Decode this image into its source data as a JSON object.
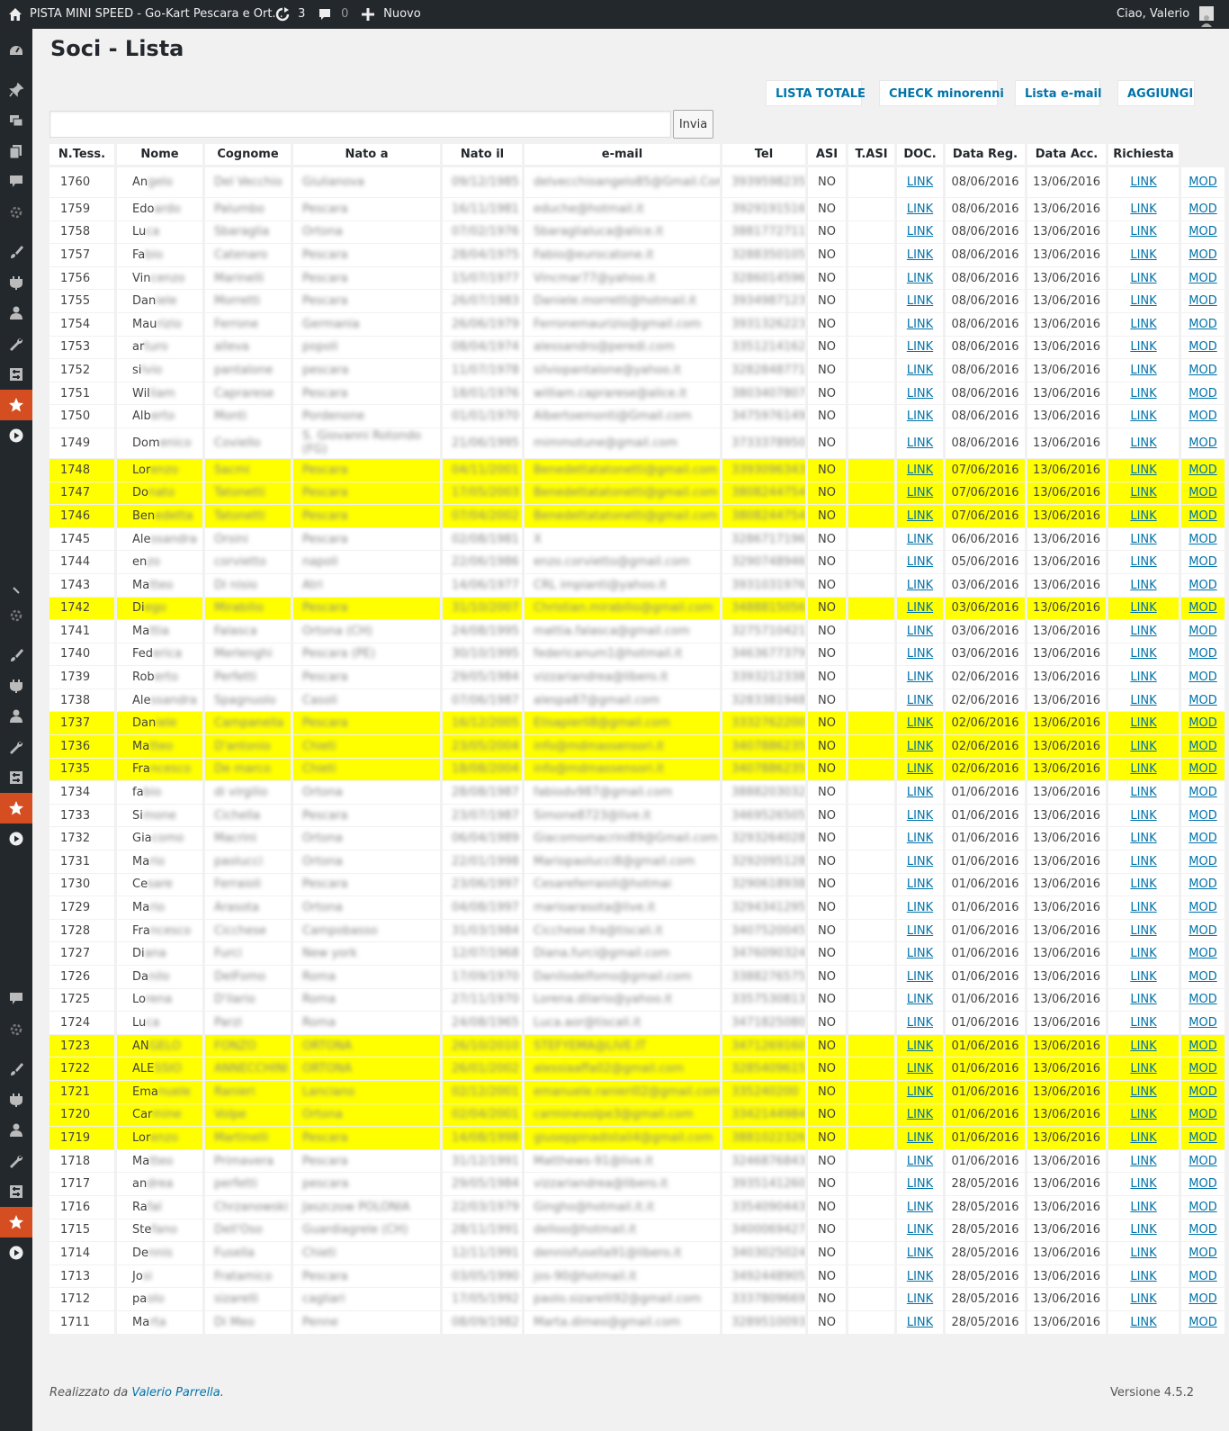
{
  "adminbar": {
    "site_title": "PISTA MINI SPEED - Go-Kart Pescara e Ort...",
    "updates_count": "3",
    "comments_count": "0",
    "new_label": "Nuovo",
    "greeting": "Ciao, Valerio"
  },
  "page": {
    "title": "Soci - Lista",
    "buttons": {
      "lista_totale": "LISTA TOTALE",
      "check_minorenni": "CHECK minorenni",
      "lista_email": "Lista e-mail",
      "aggiungi": "AGGIUNGI"
    },
    "search": {
      "value": "",
      "submit": "Invia"
    }
  },
  "table": {
    "headers": [
      "N.Tess.",
      "Nome",
      "Cognome",
      "Nato a",
      "Nato il",
      "e-mail",
      "Tel",
      "ASI",
      "T.ASI",
      "DOC.",
      "Data Reg.",
      "Data Acc.",
      "Richiesta"
    ],
    "link_label": "LINK",
    "mod_label": "MOD",
    "rows": [
      {
        "n": "1760",
        "nome": "Angelo",
        "cognome": "Del Vecchio",
        "nato_a": "Giulianova",
        "nato_il": "09/12/1985",
        "email": "delvecchioangelo85@Gmail.Com",
        "tel": "3939598235",
        "asi": "NO",
        "tasi": "",
        "reg": "08/06/2016",
        "acc": "13/06/2016",
        "hl": false,
        "tall": true
      },
      {
        "n": "1759",
        "nome": "Edoardo",
        "cognome": "Palumbo",
        "nato_a": "Pescara",
        "nato_il": "16/11/1981",
        "email": "eduche@hotmail.it",
        "tel": "3929191516",
        "asi": "NO",
        "tasi": "",
        "reg": "08/06/2016",
        "acc": "13/06/2016",
        "hl": false
      },
      {
        "n": "1758",
        "nome": "Luca",
        "cognome": "Sbaraglia",
        "nato_a": "Ortona",
        "nato_il": "07/02/1976",
        "email": "Sbaraglialuca@alice.it",
        "tel": "3881772711",
        "asi": "NO",
        "tasi": "",
        "reg": "08/06/2016",
        "acc": "13/06/2016",
        "hl": false
      },
      {
        "n": "1757",
        "nome": "Fabio",
        "cognome": "Catenaro",
        "nato_a": "Pescara",
        "nato_il": "28/04/1975",
        "email": "Fabio@eurocatone.it",
        "tel": "3288350105",
        "asi": "NO",
        "tasi": "",
        "reg": "08/06/2016",
        "acc": "13/06/2016",
        "hl": false
      },
      {
        "n": "1756",
        "nome": "Vincenzo",
        "cognome": "Marinelli",
        "nato_a": "Pescara",
        "nato_il": "15/07/1977",
        "email": "Vincmar77@yahoo.it",
        "tel": "3286014596",
        "asi": "NO",
        "tasi": "",
        "reg": "08/06/2016",
        "acc": "13/06/2016",
        "hl": false
      },
      {
        "n": "1755",
        "nome": "Daniele",
        "cognome": "Morretti",
        "nato_a": "Pescara",
        "nato_il": "26/07/1983",
        "email": "Daniele.morretti@hotmail.it",
        "tel": "3934987123",
        "asi": "NO",
        "tasi": "",
        "reg": "08/06/2016",
        "acc": "13/06/2016",
        "hl": false
      },
      {
        "n": "1754",
        "nome": "Maurizio",
        "cognome": "Ferrone",
        "nato_a": "Germania",
        "nato_il": "26/06/1979",
        "email": "Ferronemaurizio@gmail.com",
        "tel": "3931326223",
        "asi": "NO",
        "tasi": "",
        "reg": "08/06/2016",
        "acc": "13/06/2016",
        "hl": false
      },
      {
        "n": "1753",
        "nome": "arturo",
        "cognome": "alleva",
        "nato_a": "popoli",
        "nato_il": "08/04/1974",
        "email": "alessandro@peredi.com",
        "tel": "3351214162",
        "asi": "NO",
        "tasi": "",
        "reg": "08/06/2016",
        "acc": "13/06/2016",
        "hl": false
      },
      {
        "n": "1752",
        "nome": "silvio",
        "cognome": "pantalone",
        "nato_a": "pescara",
        "nato_il": "11/07/1978",
        "email": "silviopantalone@yahoo.it",
        "tel": "3282848771",
        "asi": "NO",
        "tasi": "",
        "reg": "08/06/2016",
        "acc": "13/06/2016",
        "hl": false
      },
      {
        "n": "1751",
        "nome": "William",
        "cognome": "Caprarese",
        "nato_a": "Pescara",
        "nato_il": "18/01/1976",
        "email": "william.caprarese@alice.it",
        "tel": "3803407807",
        "asi": "NO",
        "tasi": "",
        "reg": "08/06/2016",
        "acc": "13/06/2016",
        "hl": false
      },
      {
        "n": "1750",
        "nome": "Alberto",
        "cognome": "Monti",
        "nato_a": "Pordenone",
        "nato_il": "01/01/1970",
        "email": "Albertoemonti@Gmail.com",
        "tel": "3475976149",
        "asi": "NO",
        "tasi": "",
        "reg": "08/06/2016",
        "acc": "13/06/2016",
        "hl": false
      },
      {
        "n": "1749",
        "nome": "Domenico",
        "cognome": "Coviello",
        "nato_a": "S. Giovanni Rotondo (FG)",
        "nato_il": "21/06/1995",
        "email": "mimmotune@gmail.com",
        "tel": "3733378950",
        "asi": "NO",
        "tasi": "",
        "reg": "08/06/2016",
        "acc": "13/06/2016",
        "hl": false,
        "tall": true
      },
      {
        "n": "1748",
        "nome": "Lorenzo",
        "cognome": "Sacmi",
        "nato_a": "Pescara",
        "nato_il": "04/11/2001",
        "email": "Benedettatatonetti@gmail.com",
        "tel": "3393096343",
        "asi": "NO",
        "tasi": "",
        "reg": "07/06/2016",
        "acc": "13/06/2016",
        "hl": true
      },
      {
        "n": "1747",
        "nome": "Donato",
        "cognome": "Tatonetti",
        "nato_a": "Pescara",
        "nato_il": "17/05/2003",
        "email": "Benedettatatonetti@gmail.com",
        "tel": "3808244754",
        "asi": "NO",
        "tasi": "",
        "reg": "07/06/2016",
        "acc": "13/06/2016",
        "hl": true
      },
      {
        "n": "1746",
        "nome": "Benedetta",
        "cognome": "Tatonetti",
        "nato_a": "Pescara",
        "nato_il": "07/04/2002",
        "email": "Benedettatatonetti@gmail.com",
        "tel": "3808244754",
        "asi": "NO",
        "tasi": "",
        "reg": "07/06/2016",
        "acc": "13/06/2016",
        "hl": true
      },
      {
        "n": "1745",
        "nome": "Alessandra",
        "cognome": "Orsini",
        "nato_a": "Pescara",
        "nato_il": "02/08/1981",
        "email": "X",
        "tel": "3286717196",
        "asi": "NO",
        "tasi": "",
        "reg": "06/06/2016",
        "acc": "13/06/2016",
        "hl": false
      },
      {
        "n": "1744",
        "nome": "enzo",
        "cognome": "corvietto",
        "nato_a": "napoli",
        "nato_il": "22/06/1986",
        "email": "enzo.corvietto@gmail.com",
        "tel": "3290748946",
        "asi": "NO",
        "tasi": "",
        "reg": "05/06/2016",
        "acc": "13/06/2016",
        "hl": false
      },
      {
        "n": "1743",
        "nome": "Matteo",
        "cognome": "Di nisio",
        "nato_a": "Atri",
        "nato_il": "14/06/1977",
        "email": "CRL impianti@yahoo.it",
        "tel": "3931031976",
        "asi": "NO",
        "tasi": "",
        "reg": "03/06/2016",
        "acc": "13/06/2016",
        "hl": false
      },
      {
        "n": "1742",
        "nome": "Diego",
        "cognome": "Mirabilio",
        "nato_a": "Pescara",
        "nato_il": "31/10/2007",
        "email": "Christian.mirabilio@gmail.com",
        "tel": "3488815056",
        "asi": "NO",
        "tasi": "",
        "reg": "03/06/2016",
        "acc": "13/06/2016",
        "hl": true
      },
      {
        "n": "1741",
        "nome": "Mattia",
        "cognome": "Falasca",
        "nato_a": "Ortona (CH)",
        "nato_il": "24/08/1995",
        "email": "mattia.falasca@gmail.com",
        "tel": "3275710421",
        "asi": "NO",
        "tasi": "",
        "reg": "03/06/2016",
        "acc": "13/06/2016",
        "hl": false
      },
      {
        "n": "1740",
        "nome": "Federica",
        "cognome": "Merlenghi",
        "nato_a": "Pescara (PE)",
        "nato_il": "30/10/1995",
        "email": "federicanum1@hotmail.it",
        "tel": "3463677379",
        "asi": "NO",
        "tasi": "",
        "reg": "03/06/2016",
        "acc": "13/06/2016",
        "hl": false
      },
      {
        "n": "1739",
        "nome": "Roberto",
        "cognome": "Perfetti",
        "nato_a": "Pescara",
        "nato_il": "29/05/1984",
        "email": "vizzariandrea@libero.it",
        "tel": "3393212338",
        "asi": "NO",
        "tasi": "",
        "reg": "02/06/2016",
        "acc": "13/06/2016",
        "hl": false
      },
      {
        "n": "1738",
        "nome": "Alessandra",
        "cognome": "Spagnuolo",
        "nato_a": "Casoli",
        "nato_il": "07/06/1987",
        "email": "alespa87@gmail.com",
        "tel": "3283381948",
        "asi": "NO",
        "tasi": "",
        "reg": "02/06/2016",
        "acc": "13/06/2016",
        "hl": false
      },
      {
        "n": "1737",
        "nome": "Daniele",
        "cognome": "Campanella",
        "nato_a": "Pescara",
        "nato_il": "16/12/2005",
        "email": "Elisapierli8@gmail.com",
        "tel": "3332762200",
        "asi": "NO",
        "tasi": "",
        "reg": "02/06/2016",
        "acc": "13/06/2016",
        "hl": true
      },
      {
        "n": "1736",
        "nome": "Matteo",
        "cognome": "D'antonio",
        "nato_a": "Chieti",
        "nato_il": "23/05/2004",
        "email": "info@mdmassensori.it",
        "tel": "3407886235",
        "asi": "NO",
        "tasi": "",
        "reg": "02/06/2016",
        "acc": "13/06/2016",
        "hl": true
      },
      {
        "n": "1735",
        "nome": "Francesco",
        "cognome": "De marco",
        "nato_a": "Chieti",
        "nato_il": "18/08/2004",
        "email": "info@mdmassensori.it",
        "tel": "3407886235",
        "asi": "NO",
        "tasi": "",
        "reg": "02/06/2016",
        "acc": "13/06/2016",
        "hl": true
      },
      {
        "n": "1734",
        "nome": "fabio",
        "cognome": "di virgilio",
        "nato_a": "Ortona",
        "nato_il": "28/08/1987",
        "email": "fabiodv987@gmail.com",
        "tel": "3888203032",
        "asi": "NO",
        "tasi": "",
        "reg": "01/06/2016",
        "acc": "13/06/2016",
        "hl": false
      },
      {
        "n": "1733",
        "nome": "Simone",
        "cognome": "Cichella",
        "nato_a": "Pescara",
        "nato_il": "23/07/1987",
        "email": "Simone8723@live.it",
        "tel": "3469526505",
        "asi": "NO",
        "tasi": "",
        "reg": "01/06/2016",
        "acc": "13/06/2016",
        "hl": false
      },
      {
        "n": "1732",
        "nome": "Giacomo",
        "cognome": "Macrini",
        "nato_a": "Ortona",
        "nato_il": "06/04/1989",
        "email": "Giacomomacrini89@Gmail.com",
        "tel": "3293264028",
        "asi": "NO",
        "tasi": "",
        "reg": "01/06/2016",
        "acc": "13/06/2016",
        "hl": false
      },
      {
        "n": "1731",
        "nome": "Mario",
        "cognome": "paolucci",
        "nato_a": "Ortona",
        "nato_il": "22/01/1998",
        "email": "Mariopaolucci8@gmail.com",
        "tel": "3292095128",
        "asi": "NO",
        "tasi": "",
        "reg": "01/06/2016",
        "acc": "13/06/2016",
        "hl": false
      },
      {
        "n": "1730",
        "nome": "Cesare",
        "cognome": "Ferraioli",
        "nato_a": "Pescara",
        "nato_il": "23/06/1997",
        "email": "Cesareferraioli@hotmai",
        "tel": "3290618938",
        "asi": "NO",
        "tasi": "",
        "reg": "01/06/2016",
        "acc": "13/06/2016",
        "hl": false
      },
      {
        "n": "1729",
        "nome": "Mario",
        "cognome": "Arasota",
        "nato_a": "Ortona",
        "nato_il": "04/08/1997",
        "email": "marioarasota@live.it",
        "tel": "3294341295",
        "asi": "NO",
        "tasi": "",
        "reg": "01/06/2016",
        "acc": "13/06/2016",
        "hl": false
      },
      {
        "n": "1728",
        "nome": "Francesco",
        "cognome": "Cicchese",
        "nato_a": "Campobasso",
        "nato_il": "31/03/1984",
        "email": "Cicchese.fra@tiscali.it",
        "tel": "3407520045",
        "asi": "NO",
        "tasi": "",
        "reg": "01/06/2016",
        "acc": "13/06/2016",
        "hl": false
      },
      {
        "n": "1727",
        "nome": "Diana",
        "cognome": "Furci",
        "nato_a": "New york",
        "nato_il": "12/07/1968",
        "email": "Diana.furci@gmail.com",
        "tel": "3476090324",
        "asi": "NO",
        "tasi": "",
        "reg": "01/06/2016",
        "acc": "13/06/2016",
        "hl": false
      },
      {
        "n": "1726",
        "nome": "Danilo",
        "cognome": "DelFomo",
        "nato_a": "Roma",
        "nato_il": "17/09/1970",
        "email": "Danilodelfomo@gmail.com",
        "tel": "3388276575",
        "asi": "NO",
        "tasi": "",
        "reg": "01/06/2016",
        "acc": "13/06/2016",
        "hl": false
      },
      {
        "n": "1725",
        "nome": "Lorena",
        "cognome": "D'ilario",
        "nato_a": "Roma",
        "nato_il": "27/11/1970",
        "email": "Lorena.dilario@yahoo.it",
        "tel": "3357530813",
        "asi": "NO",
        "tasi": "",
        "reg": "01/06/2016",
        "acc": "13/06/2016",
        "hl": false
      },
      {
        "n": "1724",
        "nome": "Luca",
        "cognome": "Parzi",
        "nato_a": "Roma",
        "nato_il": "24/08/1965",
        "email": "Luca.aor@tiscali.it",
        "tel": "3471825080",
        "asi": "NO",
        "tasi": "",
        "reg": "01/06/2016",
        "acc": "13/06/2016",
        "hl": false
      },
      {
        "n": "1723",
        "nome": "ANGELO",
        "cognome": "FONZO",
        "nato_a": "ORTONA",
        "nato_il": "26/10/2010",
        "email": "STEFYEMA@LIVE.IT",
        "tel": "3471269160",
        "asi": "NO",
        "tasi": "",
        "reg": "01/06/2016",
        "acc": "13/06/2016",
        "hl": true
      },
      {
        "n": "1722",
        "nome": "ALESSIO",
        "cognome": "ANNECCHINI",
        "nato_a": "ORTONA",
        "nato_il": "26/01/2002",
        "email": "alessiaaffa02@gmail.com",
        "tel": "3285409615",
        "asi": "NO",
        "tasi": "",
        "reg": "01/06/2016",
        "acc": "13/06/2016",
        "hl": true
      },
      {
        "n": "1721",
        "nome": "Emanuele",
        "cognome": "Ranieri",
        "nato_a": "Lanciano",
        "nato_il": "02/12/2001",
        "email": "emanuele.ranieri02@gmail.com",
        "tel": "335240200",
        "asi": "NO",
        "tasi": "",
        "reg": "01/06/2016",
        "acc": "13/06/2016",
        "hl": true
      },
      {
        "n": "1720",
        "nome": "Carmine",
        "cognome": "Volpe",
        "nato_a": "Ortona",
        "nato_il": "02/04/2001",
        "email": "carminevolpe3@gmail.com",
        "tel": "3342144984",
        "asi": "NO",
        "tasi": "",
        "reg": "01/06/2016",
        "acc": "13/06/2016",
        "hl": true
      },
      {
        "n": "1719",
        "nome": "Lorenzo",
        "cognome": "Martinelli",
        "nato_a": "Pescara",
        "nato_il": "14/08/1998",
        "email": "giuseppinadistali4@gmail.com",
        "tel": "3881022326",
        "asi": "NO",
        "tasi": "",
        "reg": "01/06/2016",
        "acc": "13/06/2016",
        "hl": true
      },
      {
        "n": "1718",
        "nome": "Matteo",
        "cognome": "Primavera",
        "nato_a": "Pescara",
        "nato_il": "31/12/1991",
        "email": "Matthews-91@live.it",
        "tel": "3246876843",
        "asi": "NO",
        "tasi": "",
        "reg": "01/06/2016",
        "acc": "13/06/2016",
        "hl": false
      },
      {
        "n": "1717",
        "nome": "andrea",
        "cognome": "perfetti",
        "nato_a": "pescara",
        "nato_il": "29/05/1984",
        "email": "vizzariandrea@libero.it",
        "tel": "3935141260",
        "asi": "NO",
        "tasi": "",
        "reg": "28/05/2016",
        "acc": "13/06/2016",
        "hl": false
      },
      {
        "n": "1716",
        "nome": "Rafal",
        "cognome": "Chrzanowski",
        "nato_a": "Jaszczow POLONIA",
        "nato_il": "22/03/1979",
        "email": "Gingho@hotmail.it.it",
        "tel": "3354090443",
        "asi": "NO",
        "tasi": "",
        "reg": "28/05/2016",
        "acc": "13/06/2016",
        "hl": false
      },
      {
        "n": "1715",
        "nome": "Stefano",
        "cognome": "Dell'Oso",
        "nato_a": "Guardiagrele (CH)",
        "nato_il": "28/11/1991",
        "email": "delloo@hotmail.it",
        "tel": "3400069427",
        "asi": "NO",
        "tasi": "",
        "reg": "28/05/2016",
        "acc": "13/06/2016",
        "hl": false
      },
      {
        "n": "1714",
        "nome": "Dennis",
        "cognome": "Fusella",
        "nato_a": "Chieti",
        "nato_il": "12/11/1991",
        "email": "dennisfusella91@libero.it",
        "tel": "3403025024",
        "asi": "NO",
        "tasi": "",
        "reg": "28/05/2016",
        "acc": "13/06/2016",
        "hl": false
      },
      {
        "n": "1713",
        "nome": "Josi",
        "cognome": "Fratamico",
        "nato_a": "Pescara",
        "nato_il": "03/05/1990",
        "email": "jos-90@hotmail.it",
        "tel": "3492448905",
        "asi": "NO",
        "tasi": "",
        "reg": "28/05/2016",
        "acc": "13/06/2016",
        "hl": false
      },
      {
        "n": "1712",
        "nome": "paolo",
        "cognome": "sizarelli",
        "nato_a": "cagliari",
        "nato_il": "17/05/1992",
        "email": "paolo.sizarelli92@gmail.com",
        "tel": "3337809669",
        "asi": "NO",
        "tasi": "",
        "reg": "28/05/2016",
        "acc": "13/06/2016",
        "hl": false
      },
      {
        "n": "1711",
        "nome": "Marta",
        "cognome": "Di Meo",
        "nato_a": "Penne",
        "nato_il": "08/09/1982",
        "email": "Marta.dimeo@gmail.com",
        "tel": "3289510093",
        "asi": "NO",
        "tasi": "",
        "reg": "28/05/2016",
        "acc": "13/06/2016",
        "hl": false
      }
    ]
  },
  "footer": {
    "credit_prefix": "Realizzato da",
    "credit_name": "Valerio Parrella",
    "credit_suffix": ".",
    "version": "Versione 4.5.2"
  },
  "colors": {
    "highlight": "#ffff00",
    "link": "#0073aa",
    "menu_bg": "#23282d",
    "menu_active": "#d54e21"
  },
  "sidemenu": {
    "icons": [
      "dashboard-icon",
      "pin-icon",
      "media-icon",
      "pages-icon",
      "comments-icon",
      "gear-icon",
      "paint-brush-icon",
      "plugin-icon",
      "users-icon",
      "wrench-icon",
      "settings-icon",
      "star-icon",
      "play-icon",
      "collapse-icon",
      "gear-icon",
      "paint-brush-icon",
      "plugin-icon",
      "users-icon",
      "wrench-icon",
      "settings-icon",
      "star-icon",
      "play-icon",
      "comments-icon",
      "gear-icon",
      "paint-brush-icon",
      "plugin-icon",
      "users-icon",
      "wrench-icon",
      "settings-icon",
      "star-icon",
      "play-icon"
    ]
  }
}
